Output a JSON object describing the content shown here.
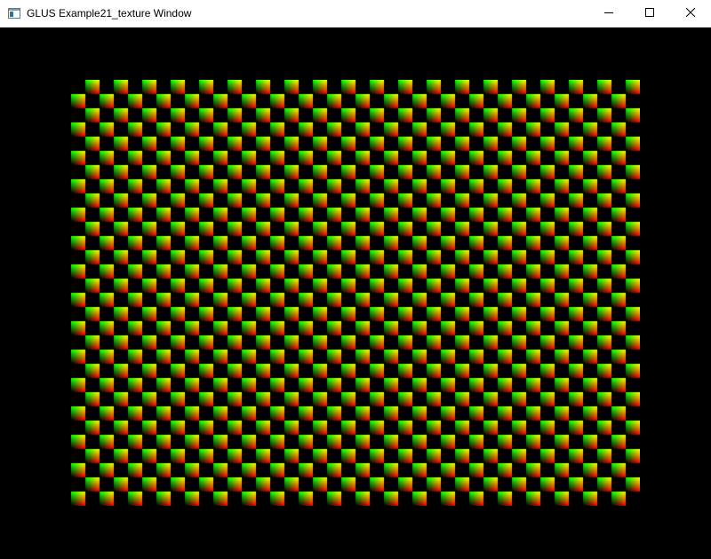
{
  "window": {
    "title": "GLUS Example21_texture Window",
    "caption_buttons": [
      "minimize",
      "maximize",
      "close"
    ],
    "icons": {
      "app": "app-window-icon",
      "minimize": "minimize-icon",
      "maximize": "maximize-icon",
      "close": "close-icon"
    }
  },
  "scene": {
    "background_color": "#000000",
    "texture": {
      "pattern": "checkerboard",
      "columns": 40,
      "rows": 30,
      "dark_color": "#000000",
      "tile_gradient": {
        "top_left": "#00ff00",
        "top_right": "#ffff00",
        "bottom_left": "#000000",
        "bottom_right": "#ff0000"
      }
    }
  }
}
